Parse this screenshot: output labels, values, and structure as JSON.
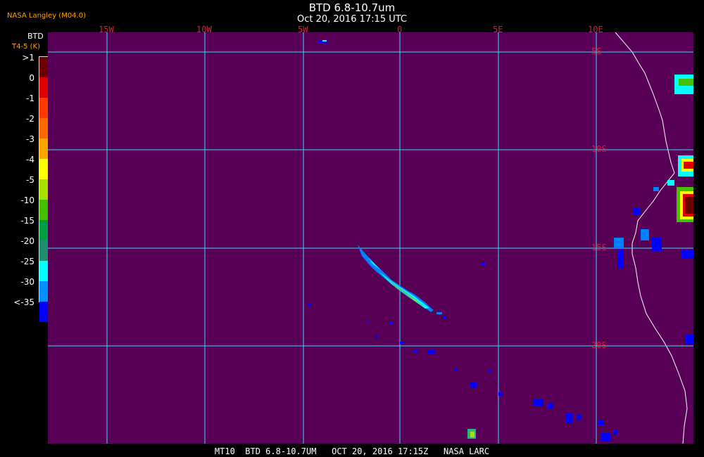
{
  "header": {
    "title": "BTD 6.8-10.7um",
    "subtitle": "Oct 20, 2016 17:15 UTC",
    "agency": "NASA Langley (M04.0)",
    "product": "BTD",
    "unit": "T4-5 (K)"
  },
  "footer": {
    "text": "MT10  BTD 6.8-10.7UM   OCT 20, 2016 17:15Z   NASA LARC"
  },
  "legend": [
    {
      "label": ">1",
      "color": "#6b0000"
    },
    {
      "label": "0",
      "color": "#e00000"
    },
    {
      "label": "-1",
      "color": "#ff3a00"
    },
    {
      "label": "-2",
      "color": "#ff6a00"
    },
    {
      "label": "-3",
      "color": "#ffa500"
    },
    {
      "label": "-4",
      "color": "#ffff00"
    },
    {
      "label": "-5",
      "color": "#a8e000"
    },
    {
      "label": "-10",
      "color": "#44c000"
    },
    {
      "label": "-15",
      "color": "#009e45"
    },
    {
      "label": "-20",
      "color": "#1f8f70"
    },
    {
      "label": "-25",
      "color": "#00ffff"
    },
    {
      "label": "-30",
      "color": "#0090ff"
    },
    {
      "label": "<-35",
      "color": "#0000ff"
    }
  ],
  "map": {
    "background": "#570055",
    "grid_color": "#3fd6ff",
    "lon_labels": [
      "15W",
      "10W",
      "5W",
      "0",
      "5E",
      "10E"
    ],
    "lat_labels": [
      "5S",
      "10S",
      "15S",
      "20S"
    ],
    "coast_color": "#ffffff"
  }
}
